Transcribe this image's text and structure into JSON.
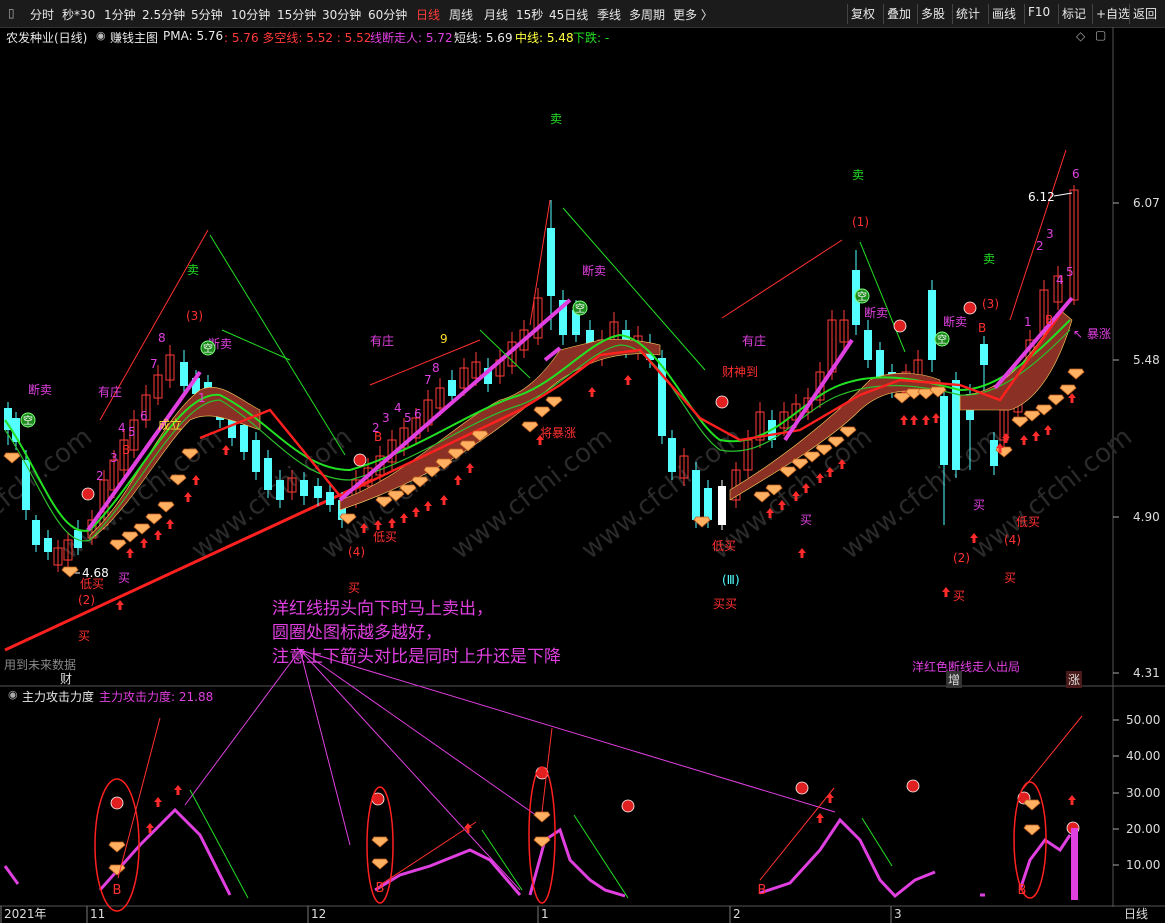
{
  "toolbar": {
    "periods": [
      "分时",
      "秒*30",
      "1分钟",
      "2.5分钟",
      "5分钟",
      "10分钟",
      "15分钟",
      "30分钟",
      "60分钟",
      "日线",
      "周线",
      "月线",
      "15秒",
      "45日线",
      "季线",
      "多周期",
      "更多 〉"
    ],
    "active_period": "日线",
    "right_buttons": [
      "复权",
      "叠加",
      "多股",
      "统计",
      "画线",
      "F10",
      "标记",
      "+自选",
      "返回"
    ]
  },
  "main": {
    "stock_title": "农发种业(日线)",
    "indicator_name": "赚钱主图",
    "pma_label": "PMA: 5.76",
    "duokong": ": 5.76 多空线: 5.52 : 5.52",
    "duanxian_ren": "线断走人: 5.72",
    "short": "短线: 5.69",
    "mid": "中线: 5.48",
    "down": "下跌: -",
    "y_ticks": [
      "6.07",
      "5.48",
      "4.90",
      "4.31"
    ],
    "price_low_label": "4.68",
    "price_high_label": "6.12",
    "future_data_label": "用到未来数据",
    "cai_label": "财",
    "bottom_right_note": "洋红色断线走人出局",
    "zeng_label": "增",
    "zhang_label": "涨"
  },
  "annotations": {
    "note_lines": [
      "洋红线拐头向下时马上卖出，",
      "圆圈处图标越多越好，",
      "注意上下箭头对比是同时上升还是下降"
    ]
  },
  "sub": {
    "title": "主力攻击力度",
    "value_label": "主力攻击力度: 21.88",
    "y_ticks": [
      "50.00",
      "40.00",
      "30.00",
      "20.00",
      "10.00"
    ]
  },
  "xaxis": {
    "labels": [
      "2021年",
      "11",
      "12",
      "1",
      "2",
      "3"
    ],
    "period_label": "日线"
  },
  "colors": {
    "up": "#ff3a3a",
    "down": "#54ffff",
    "magenta": "#e040e0",
    "green_line": "#22e022",
    "main_line": "#ff2020"
  }
}
